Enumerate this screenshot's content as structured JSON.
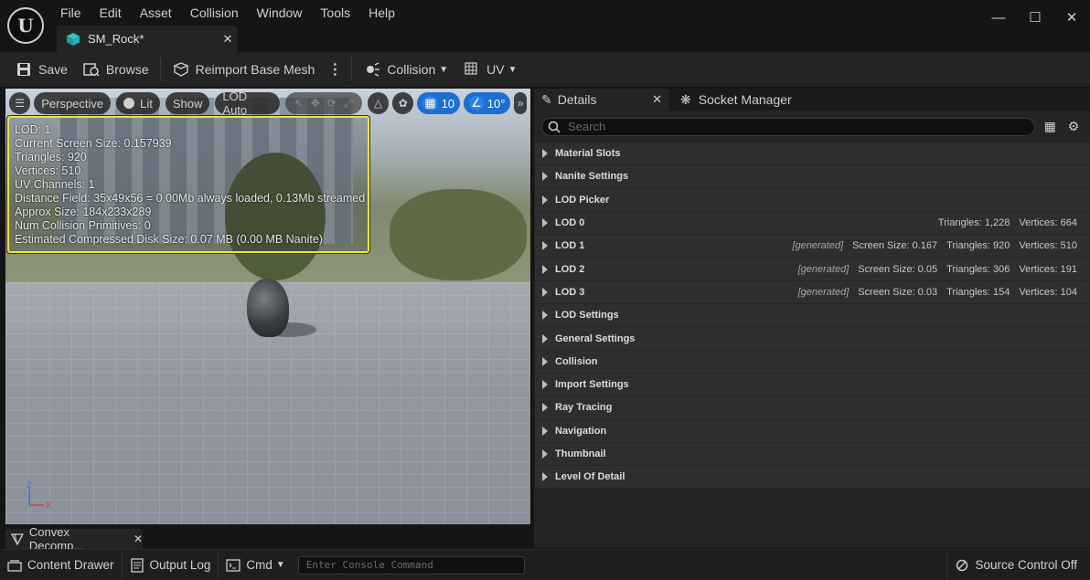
{
  "menu": [
    "File",
    "Edit",
    "Asset",
    "Collision",
    "Window",
    "Tools",
    "Help"
  ],
  "document_tab": {
    "title": "SM_Rock*"
  },
  "toolbar": {
    "save": "Save",
    "browse": "Browse",
    "reimport": "Reimport Base Mesh",
    "collision": "Collision",
    "uv": "UV"
  },
  "viewport": {
    "perspective": "Perspective",
    "lit": "Lit",
    "show": "Show",
    "lod": "LOD Auto",
    "grid_snap": "10",
    "angle_snap": "10°",
    "stats": [
      "LOD:  1",
      "Current Screen Size:  0.157939",
      "Triangles:  920",
      "Vertices:  510",
      "UV Channels:  1",
      "Distance Field:  35x49x56 = 0.00Mb always loaded, 0.13Mb streamed",
      "Approx Size: 184x233x289",
      "Num Collision Primitives:  0",
      "Estimated Compressed Disk Size: 0.07 MB (0.00 MB Nanite)"
    ],
    "axis": {
      "z": "Z",
      "x": "X"
    }
  },
  "details": {
    "tab": "Details",
    "socket_tab": "Socket Manager",
    "search_placeholder": "Search",
    "rows": [
      {
        "name": "Material Slots",
        "meta": []
      },
      {
        "name": "Nanite Settings",
        "meta": []
      },
      {
        "name": "LOD Picker",
        "meta": []
      },
      {
        "name": "LOD 0",
        "meta": [
          "Triangles: 1,228",
          "Vertices: 664"
        ]
      },
      {
        "name": "LOD 1",
        "gen": "[generated]",
        "meta": [
          "Screen Size: 0.167",
          "Triangles: 920",
          "Vertices: 510"
        ]
      },
      {
        "name": "LOD 2",
        "gen": "[generated]",
        "meta": [
          "Screen Size: 0.05",
          "Triangles: 306",
          "Vertices: 191"
        ]
      },
      {
        "name": "LOD 3",
        "gen": "[generated]",
        "meta": [
          "Screen Size: 0.03",
          "Triangles: 154",
          "Vertices: 104"
        ]
      },
      {
        "name": "LOD Settings",
        "meta": []
      },
      {
        "name": "General Settings",
        "meta": []
      },
      {
        "name": "Collision",
        "meta": []
      },
      {
        "name": "Import Settings",
        "meta": []
      },
      {
        "name": "Ray Tracing",
        "meta": []
      },
      {
        "name": "Navigation",
        "meta": []
      },
      {
        "name": "Thumbnail",
        "meta": []
      },
      {
        "name": "Level Of Detail",
        "meta": []
      }
    ]
  },
  "bottom_tab": {
    "title": "Convex Decomp..."
  },
  "statusbar": {
    "content_drawer": "Content Drawer",
    "output_log": "Output Log",
    "cmd": "Cmd",
    "console_placeholder": "Enter Console Command",
    "source_control": "Source Control Off"
  },
  "colors": {
    "accent_blue": "#1a6fd0",
    "stats_border": "#f0e23a",
    "panel_bg": "#242424"
  }
}
